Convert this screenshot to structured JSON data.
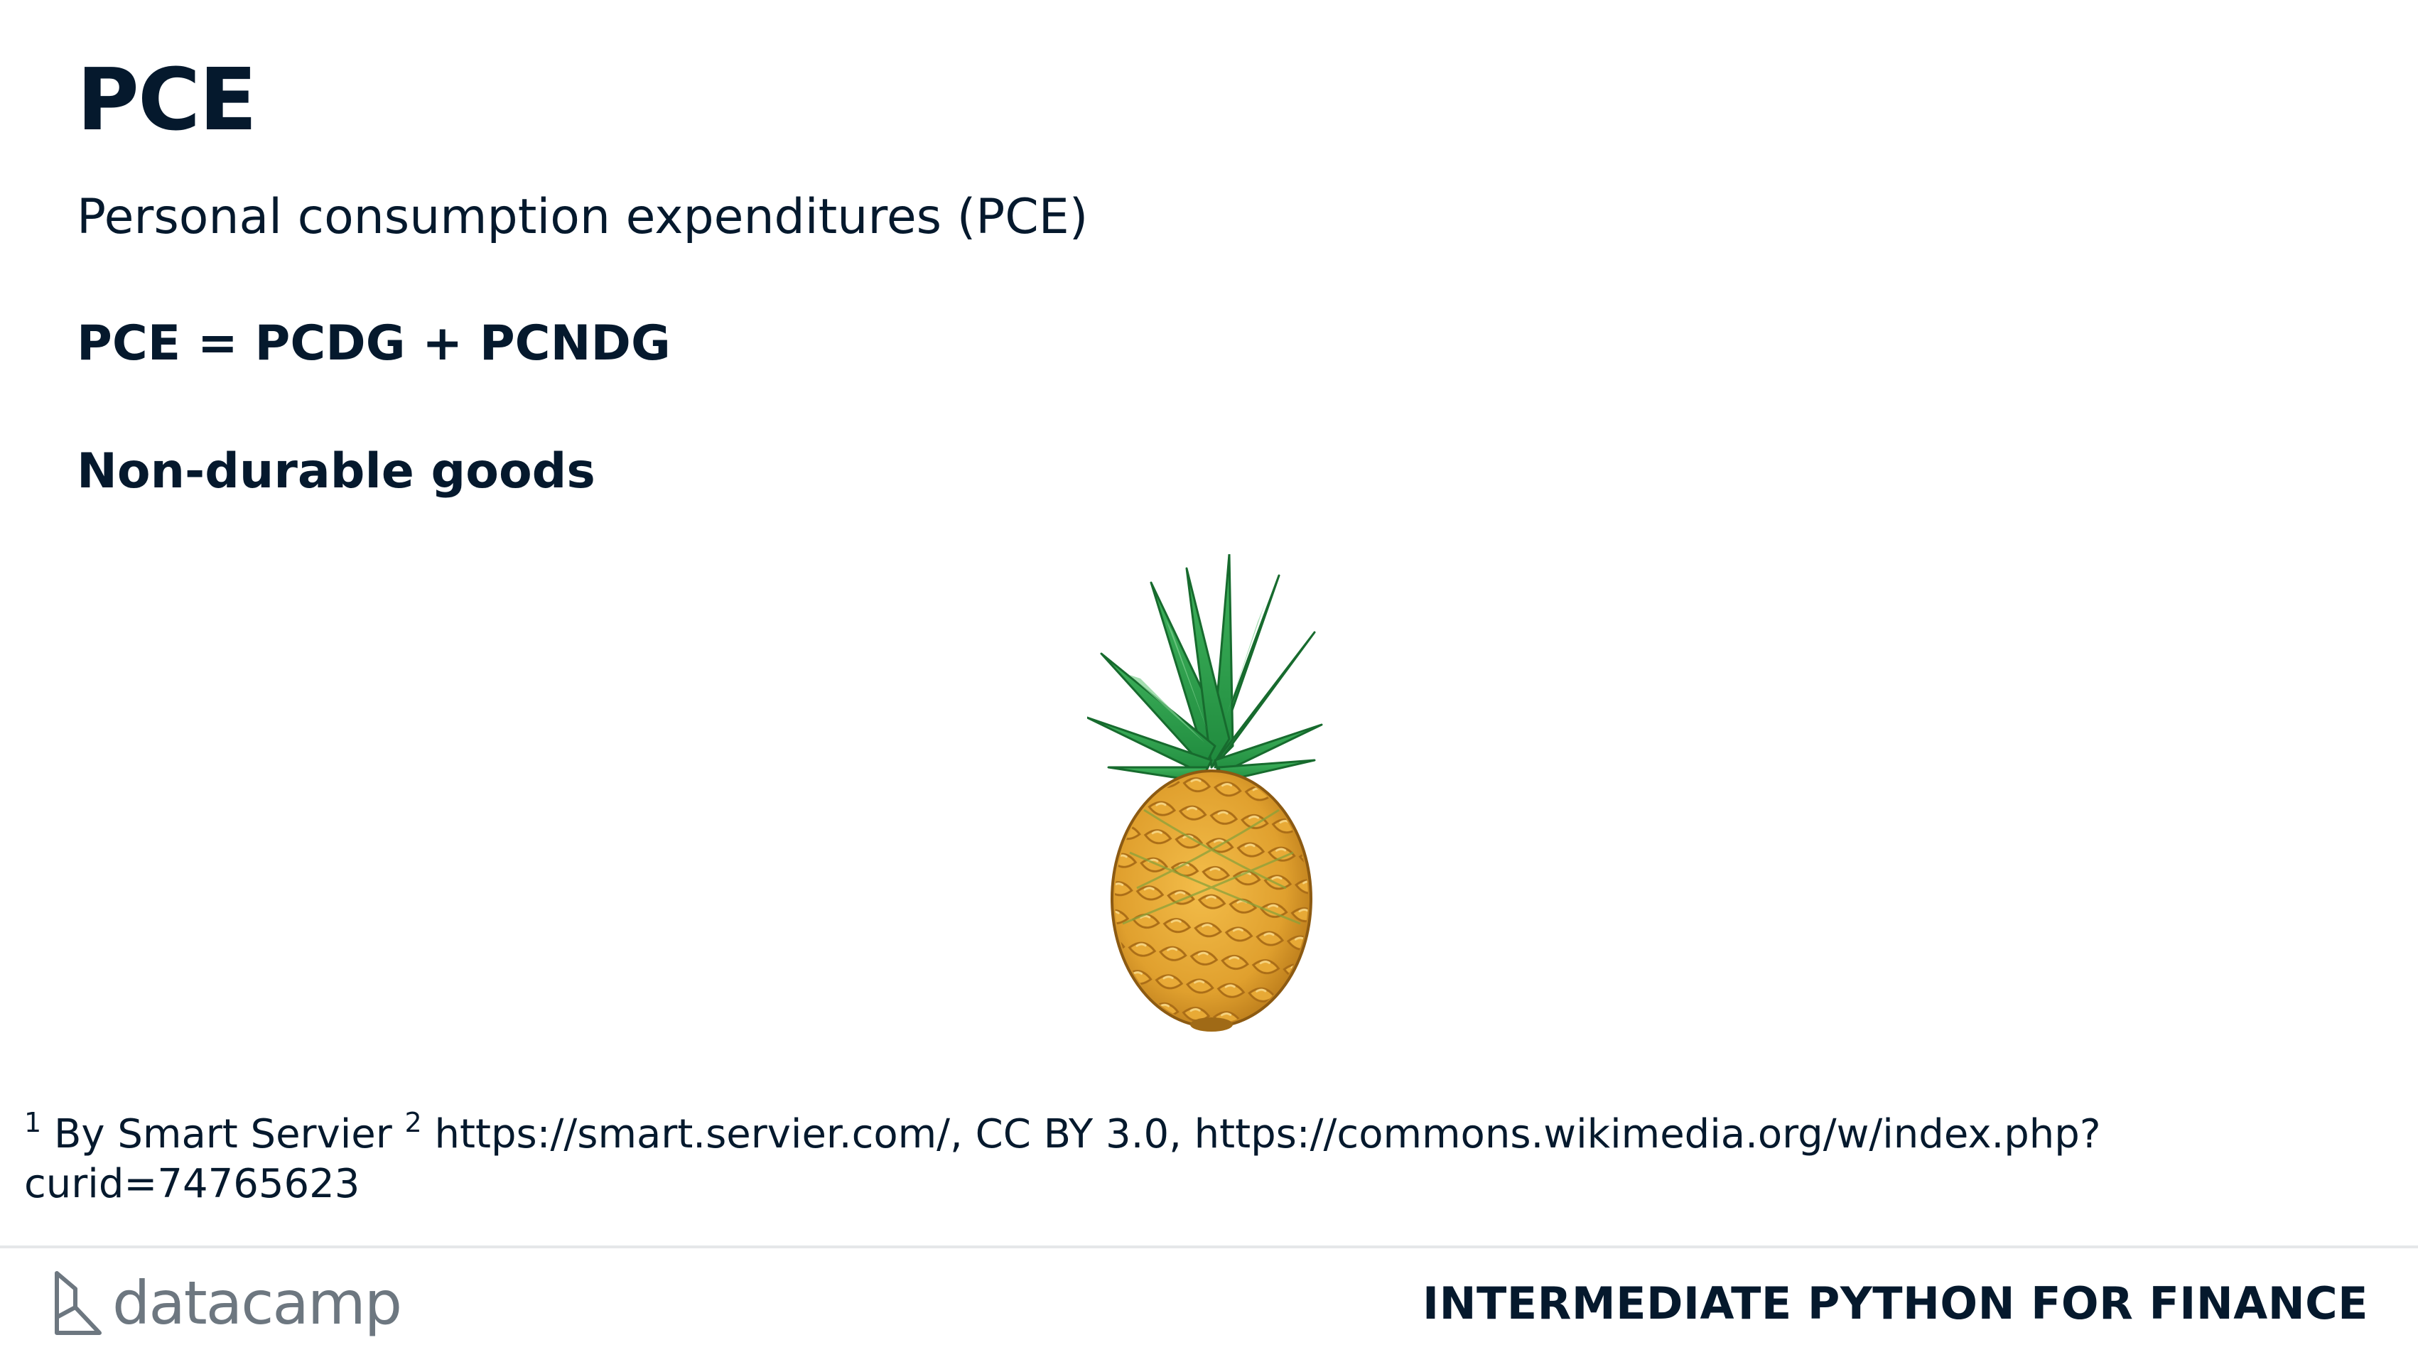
{
  "slide": {
    "title": "PCE",
    "subtitle": "Personal consumption expenditures (PCE)",
    "formula": "PCE = PCDG + PCNDG",
    "subheading": "Non-durable goods",
    "image_icon": "pineapple-illustration"
  },
  "footnote": {
    "marker1": "1",
    "text1": " By Smart Servier ",
    "marker2": "2",
    "text2": " https://smart.servier.com/, CC BY 3.0, https://commons.wikimedia.org/w/index.php?curid=74765623"
  },
  "footer": {
    "logo_text": "datacamp",
    "course_title": "INTERMEDIATE PYTHON FOR FINANCE"
  },
  "colors": {
    "text": "#05192d",
    "logo_gray": "#6d7780",
    "divider": "#e5e7e9",
    "leaf_green": "#2e9e4a",
    "fruit_orange": "#e4a431"
  }
}
